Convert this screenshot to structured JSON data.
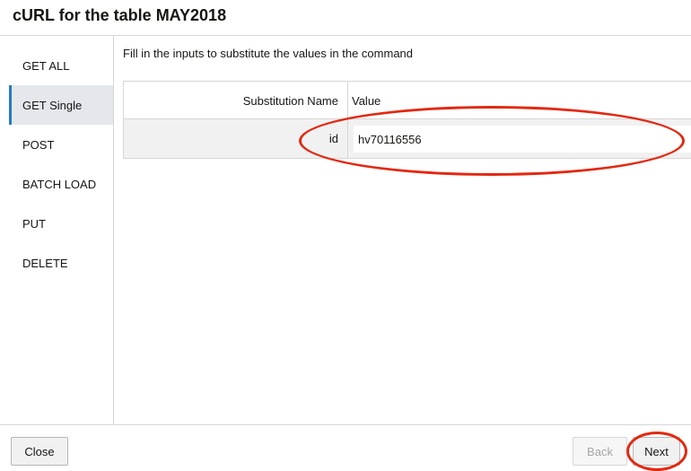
{
  "dialog": {
    "title": "cURL for the table MAY2018"
  },
  "sidebar": {
    "items": [
      {
        "label": "GET ALL",
        "selected": false
      },
      {
        "label": "GET Single",
        "selected": true
      },
      {
        "label": "POST",
        "selected": false
      },
      {
        "label": "BATCH LOAD",
        "selected": false
      },
      {
        "label": "PUT",
        "selected": false
      },
      {
        "label": "DELETE",
        "selected": false
      }
    ]
  },
  "main": {
    "instructions": "Fill in the inputs to substitute the values in the command",
    "table": {
      "headers": {
        "name": "Substitution Name",
        "value": "Value"
      },
      "rows": [
        {
          "name": "id",
          "value": "hv70116556"
        }
      ]
    }
  },
  "footer": {
    "close_label": "Close",
    "back_label": "Back",
    "next_label": "Next"
  },
  "colors": {
    "accent": "#227ac7",
    "annotation": "#e32810",
    "selected_bg": "#e4e7ec"
  }
}
